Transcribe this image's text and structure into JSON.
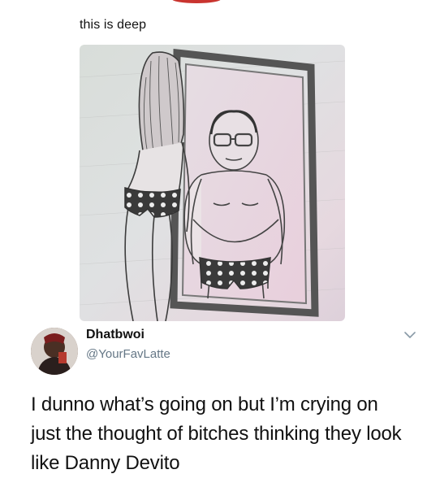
{
  "post": {
    "caption": "this is deep",
    "image": {
      "description_icon": "pencil-sketch-mirror-image"
    }
  },
  "tweet": {
    "display_name": "Dhatbwoi",
    "handle": "@YourFavLatte",
    "text": "I dunno what’s going on but I’m crying on just the thought of bitches thinking they look like Danny Devito",
    "menu_icon": "chevron-down-icon"
  },
  "colors": {
    "text": "#111111",
    "handle": "#657786",
    "background": "#ffffff",
    "accent_sliver": "#c9342f"
  }
}
